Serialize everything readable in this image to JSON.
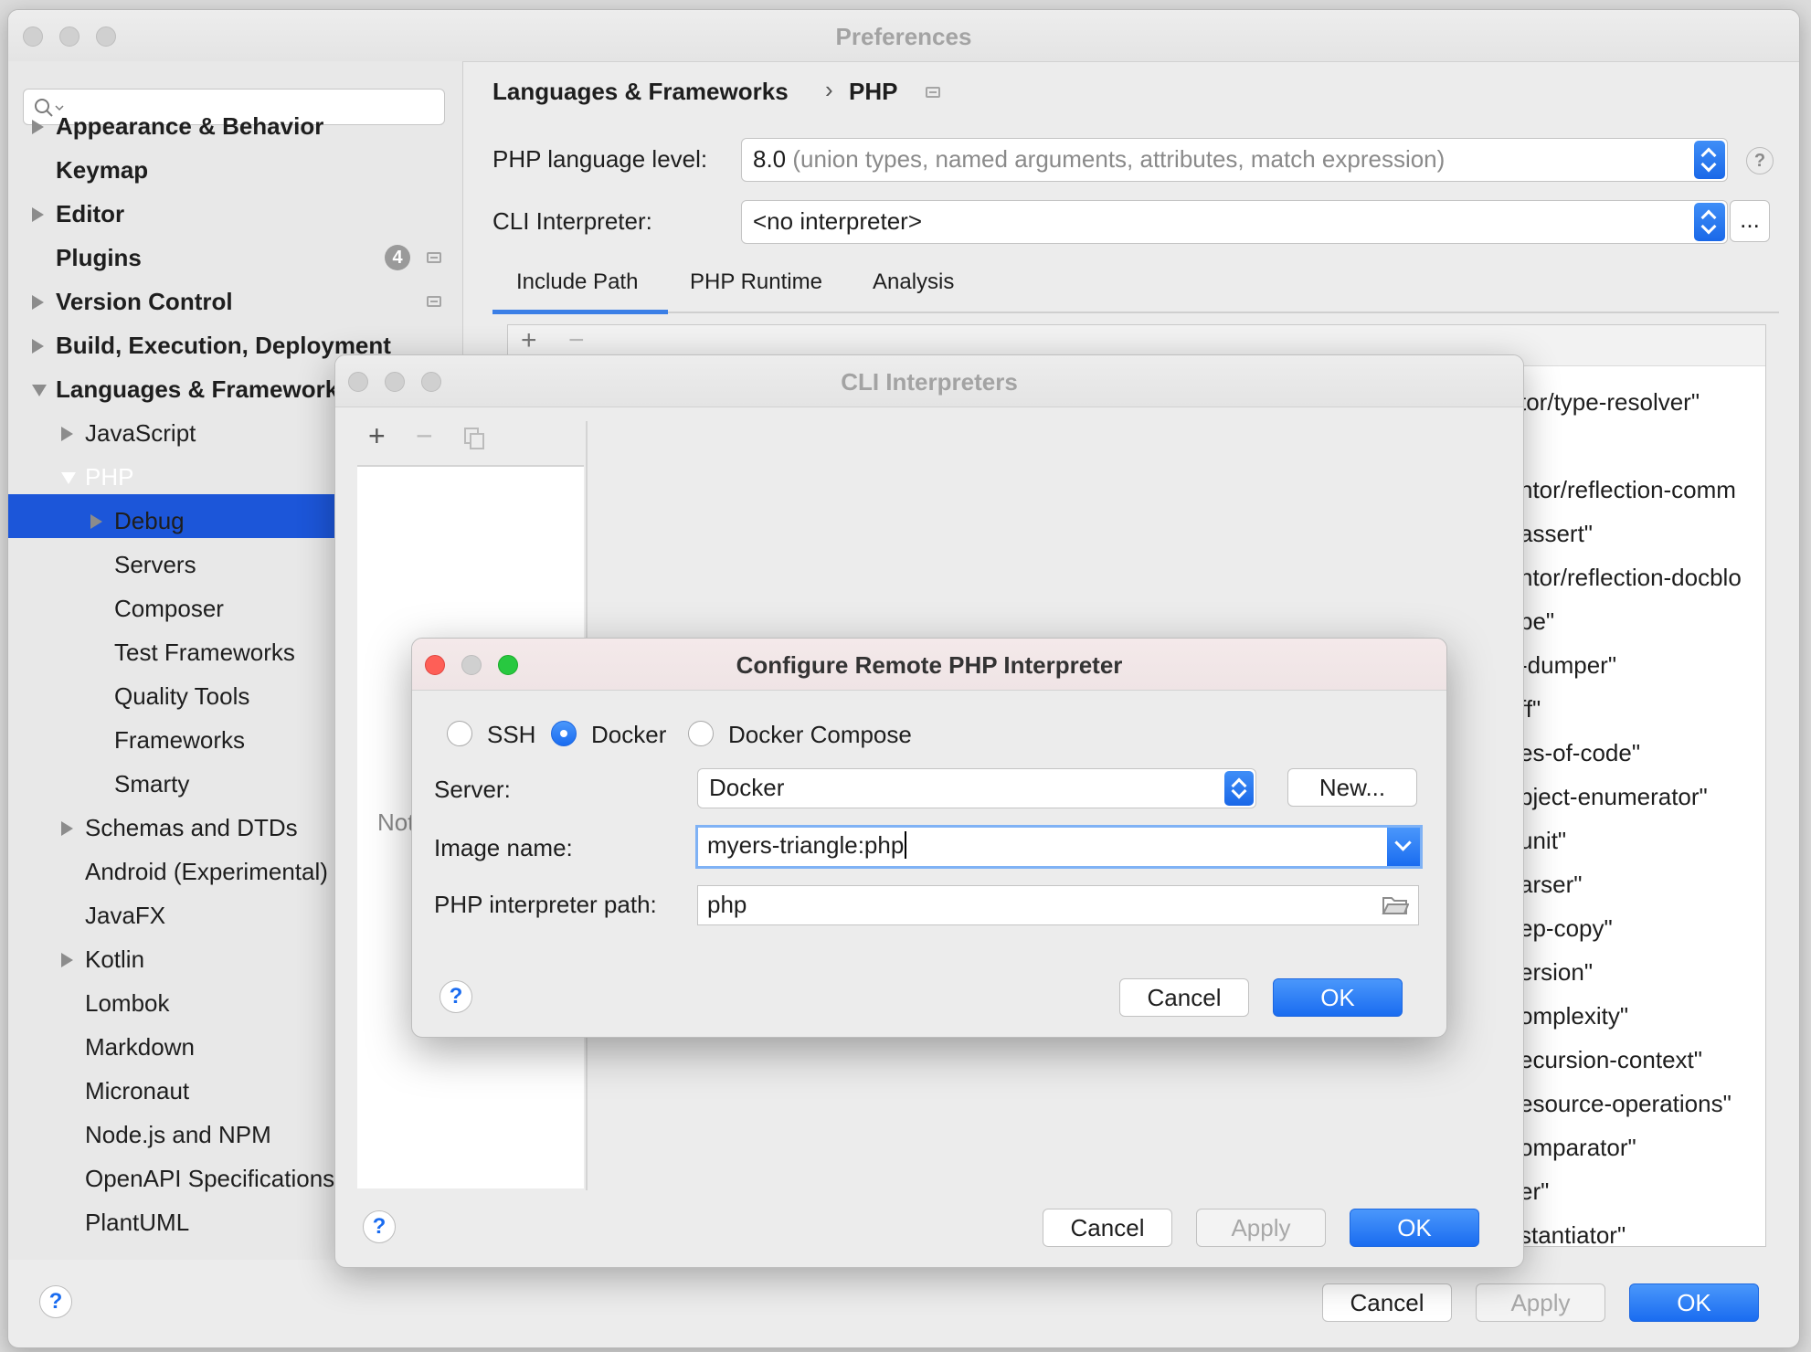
{
  "prefs": {
    "title": "Preferences",
    "search": {
      "value": ""
    },
    "sidebar_items": [
      {
        "label": "Appearance & Behavior",
        "level": 0,
        "bold": true,
        "arrow": "right"
      },
      {
        "label": "Keymap",
        "level": 0,
        "bold": true,
        "arrow": "none"
      },
      {
        "label": "Editor",
        "level": 0,
        "bold": true,
        "arrow": "right"
      },
      {
        "label": "Plugins",
        "level": 0,
        "bold": true,
        "arrow": "none",
        "badge": "4"
      },
      {
        "label": "Version Control",
        "level": 0,
        "bold": true,
        "arrow": "right"
      },
      {
        "label": "Build, Execution, Deployment",
        "level": 0,
        "bold": true,
        "arrow": "right"
      },
      {
        "label": "Languages & Frameworks",
        "level": 0,
        "bold": true,
        "arrow": "down"
      },
      {
        "label": "JavaScript",
        "level": 1,
        "arrow": "right"
      },
      {
        "label": "PHP",
        "level": 1,
        "arrow": "down",
        "selected": true
      },
      {
        "label": "Debug",
        "level": 2,
        "arrow": "right"
      },
      {
        "label": "Servers",
        "level": 2,
        "arrow": "none"
      },
      {
        "label": "Composer",
        "level": 2,
        "arrow": "none"
      },
      {
        "label": "Test Frameworks",
        "level": 2,
        "arrow": "none"
      },
      {
        "label": "Quality Tools",
        "level": 2,
        "arrow": "none"
      },
      {
        "label": "Frameworks",
        "level": 2,
        "arrow": "none"
      },
      {
        "label": "Smarty",
        "level": 2,
        "arrow": "none"
      },
      {
        "label": "Schemas and DTDs",
        "level": 1,
        "arrow": "right"
      },
      {
        "label": "Android (Experimental)",
        "level": 1,
        "arrow": "none"
      },
      {
        "label": "JavaFX",
        "level": 1,
        "arrow": "none"
      },
      {
        "label": "Kotlin",
        "level": 1,
        "arrow": "right"
      },
      {
        "label": "Lombok",
        "level": 1,
        "arrow": "none"
      },
      {
        "label": "Markdown",
        "level": 1,
        "arrow": "none"
      },
      {
        "label": "Micronaut",
        "level": 1,
        "arrow": "none"
      },
      {
        "label": "Node.js and NPM",
        "level": 1,
        "arrow": "none"
      },
      {
        "label": "OpenAPI Specifications",
        "level": 1,
        "arrow": "none"
      },
      {
        "label": "PlantUML",
        "level": 1,
        "arrow": "none"
      }
    ],
    "breadcrumb": {
      "parent": "Languages & Frameworks",
      "separator": "›",
      "current": "PHP"
    },
    "language_level": {
      "label": "PHP language level:",
      "value": "8.0",
      "hint": "(union types, named arguments, attributes, match expression)"
    },
    "cli_interpreter": {
      "label": "CLI Interpreter:",
      "value": "<no interpreter>",
      "more_button": "..."
    },
    "tabs": [
      {
        "label": "Include Path",
        "active": true
      },
      {
        "label": "PHP Runtime",
        "active": false
      },
      {
        "label": "Analysis",
        "active": false
      }
    ],
    "include_paths": [
      "tor/type-resolver\"",
      "",
      "ntor/reflection-comm",
      "assert\"",
      "ntor/reflection-docblo",
      "pe\"",
      "-dumper\"",
      "ff\"",
      "es-of-code\"",
      "bject-enumerator\"",
      "unit\"",
      "arser\"",
      "ep-copy\"",
      "ersion\"",
      "omplexity\"",
      "ecursion-context\"",
      "esource-operations\"",
      "omparator\"",
      "er\"",
      "stantiator\""
    ],
    "help": "?",
    "buttons": {
      "cancel": "Cancel",
      "apply": "Apply",
      "ok": "OK"
    }
  },
  "cli": {
    "title": "CLI Interpreters",
    "toolbar": {
      "add": "+",
      "remove": "−"
    },
    "empty_text": "Nothing to show",
    "help": "?",
    "buttons": {
      "cancel": "Cancel",
      "apply": "Apply",
      "ok": "OK"
    }
  },
  "remote": {
    "title": "Configure Remote PHP Interpreter",
    "radios": [
      {
        "label": "SSH",
        "checked": false
      },
      {
        "label": "Docker",
        "checked": true
      },
      {
        "label": "Docker Compose",
        "checked": false
      }
    ],
    "server": {
      "label": "Server:",
      "value": "Docker",
      "new_button": "New..."
    },
    "image": {
      "label": "Image name:",
      "value": "myers-triangle:php"
    },
    "php_path": {
      "label": "PHP interpreter path:",
      "value": "php"
    },
    "help": "?",
    "buttons": {
      "cancel": "Cancel",
      "ok": "OK"
    }
  },
  "colors": {
    "accent": "#1a6cf0",
    "selection": "#1c56d9"
  }
}
